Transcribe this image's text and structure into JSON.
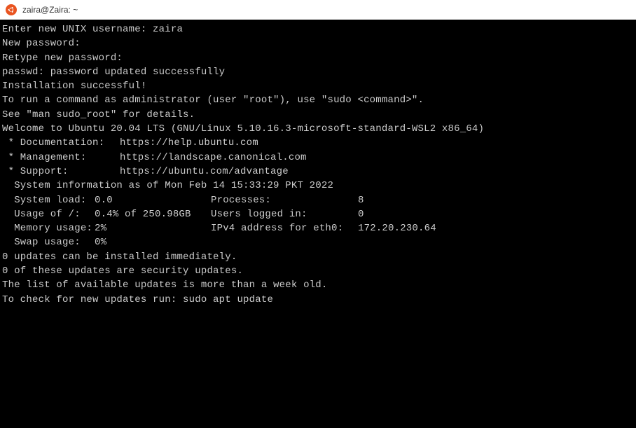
{
  "window": {
    "title": "zaira@Zaira: ~"
  },
  "lines": {
    "l1": "Enter new UNIX username: zaira",
    "l2": "New password:",
    "l3": "Retype new password:",
    "l4": "passwd: password updated successfully",
    "l5": "Installation successful!",
    "l6": "To run a command as administrator (user \"root\"), use \"sudo <command>\".",
    "l7": "See \"man sudo_root\" for details.",
    "l8": "",
    "l9": "Welcome to Ubuntu 20.04 LTS (GNU/Linux 5.10.16.3-microsoft-standard-WSL2 x86_64)",
    "l10": ""
  },
  "links": {
    "doc_label": " * Documentation:",
    "doc_url": "https://help.ubuntu.com",
    "mgmt_label": " * Management:",
    "mgmt_url": "https://landscape.canonical.com",
    "sup_label": " * Support:",
    "sup_url": "https://ubuntu.com/advantage"
  },
  "sysinfo": {
    "blank1": "",
    "header": "  System information as of Mon Feb 14 15:33:29 PKT 2022",
    "blank2": "",
    "rows": [
      {
        "a1": "  System load:",
        "a2": "0.0",
        "b1": "Processes:",
        "b2": "8"
      },
      {
        "a1": "  Usage of /:",
        "a2": "0.4% of 250.98GB",
        "b1": "Users logged in:",
        "b2": "0"
      },
      {
        "a1": "  Memory usage:",
        "a2": "2%",
        "b1": "IPv4 address for eth0:",
        "b2": "172.20.230.64"
      },
      {
        "a1": "  Swap usage:",
        "a2": "0%",
        "b1": "",
        "b2": ""
      }
    ]
  },
  "footer": {
    "blank1": "",
    "u1": "0 updates can be installed immediately.",
    "u2": "0 of these updates are security updates.",
    "blank2": "",
    "blank3": "",
    "n1": "The list of available updates is more than a week old.",
    "n2": "To check for new updates run: sudo apt update"
  }
}
